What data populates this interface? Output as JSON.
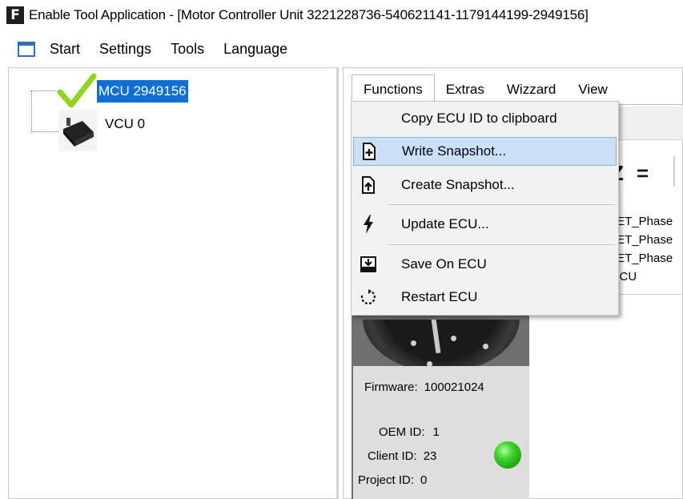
{
  "window": {
    "app_icon_letter": "F",
    "title": "Enable Tool Application - [Motor Controller Unit 3221228736-540621141-1179144199-2949156]"
  },
  "menubar": {
    "items": [
      "Start",
      "Settings",
      "Tools",
      "Language"
    ]
  },
  "tree": {
    "nodes": [
      {
        "label": "MCU 2949156",
        "selected": true,
        "icon": "check-icon"
      },
      {
        "label": "VCU 0",
        "selected": false,
        "icon": "vcu-device-icon"
      }
    ]
  },
  "tabs": [
    "Functions",
    "Extras",
    "Wizzard",
    "View"
  ],
  "functions_menu": {
    "items": [
      {
        "label": "Copy ECU ID to clipboard",
        "icon": ""
      },
      {
        "label": "Write Snapshot...",
        "icon": "write-snapshot-icon",
        "highlighted": true
      },
      {
        "label": "Create Snapshot...",
        "icon": "create-snapshot-icon"
      },
      {
        "label": "Update ECU...",
        "icon": "lightning-icon"
      },
      {
        "label": "Save On ECU",
        "icon": "save-icon"
      },
      {
        "label": "Restart ECU",
        "icon": "restart-icon"
      }
    ]
  },
  "background_list": {
    "toolbar_glyphs": [
      "Z",
      "="
    ],
    "rows": [
      "FET_Phase",
      "FET_Phase",
      "FET_Phase",
      "MCU"
    ]
  },
  "device_info": {
    "firmware_label": "Firmware:",
    "firmware": "100021024",
    "oem_label": "OEM ID:",
    "oem_id": "1",
    "client_label": "Client ID:",
    "client_id": "23",
    "project_label": "Project ID:",
    "project_id": "0",
    "status_color": "#3fd12c"
  },
  "colors": {
    "selection": "#0f6fd4",
    "menu_hover": "#c9e0f7",
    "check": "#8fd61e"
  }
}
